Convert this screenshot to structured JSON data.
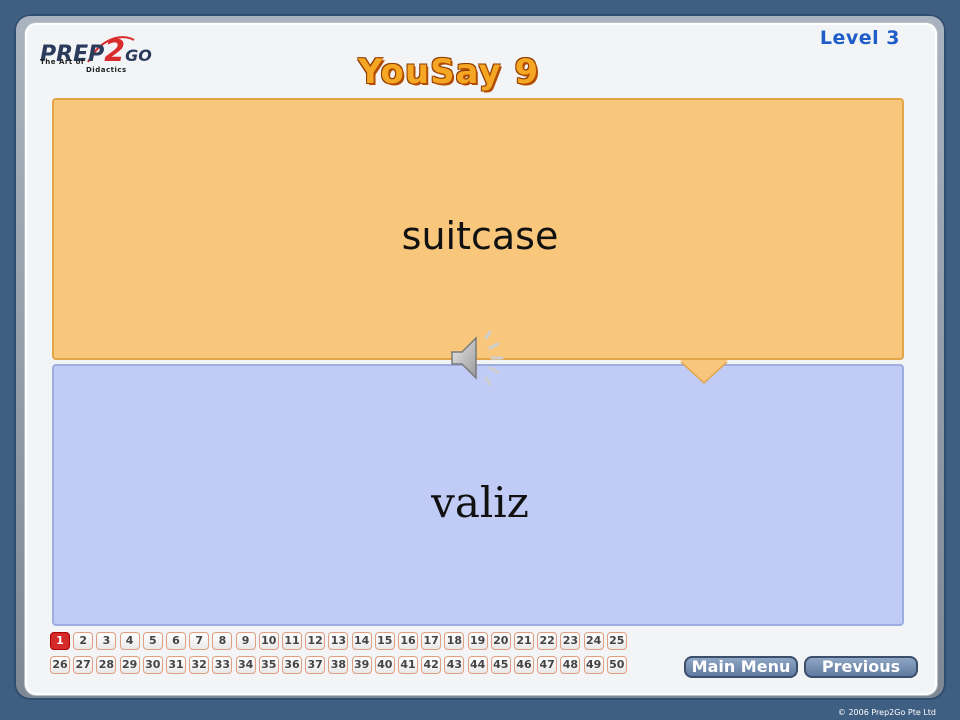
{
  "logo": {
    "main": "PREP",
    "two": "2",
    "go": "GO",
    "sub1": "The Art of",
    "sub2": "Didactics"
  },
  "level": "Level 3",
  "title": "YouSay 9",
  "card": {
    "english": "suitcase",
    "translation": "valiz"
  },
  "pages": {
    "row1": [
      "1",
      "2",
      "3",
      "4",
      "5",
      "6",
      "7",
      "8",
      "9",
      "10",
      "11",
      "12",
      "13",
      "14",
      "15",
      "16",
      "17",
      "18",
      "19",
      "20",
      "21",
      "22",
      "23",
      "24",
      "25"
    ],
    "row2": [
      "26",
      "27",
      "28",
      "29",
      "30",
      "31",
      "32",
      "33",
      "34",
      "35",
      "36",
      "37",
      "38",
      "39",
      "40",
      "41",
      "42",
      "43",
      "44",
      "45",
      "46",
      "47",
      "48",
      "49",
      "50"
    ],
    "active": "1"
  },
  "nav": {
    "main_menu": "Main Menu",
    "previous": "Previous"
  },
  "copyright": "© 2006 Prep2Go Pte Ltd",
  "colors": {
    "top_card": "#f9c77b",
    "bottom_card": "#c0ccf5",
    "level_text": "#1f5ec8",
    "title": "#f5a623",
    "active_page": "#d42a2a"
  },
  "icons": {
    "speaker": "speaker-icon"
  }
}
